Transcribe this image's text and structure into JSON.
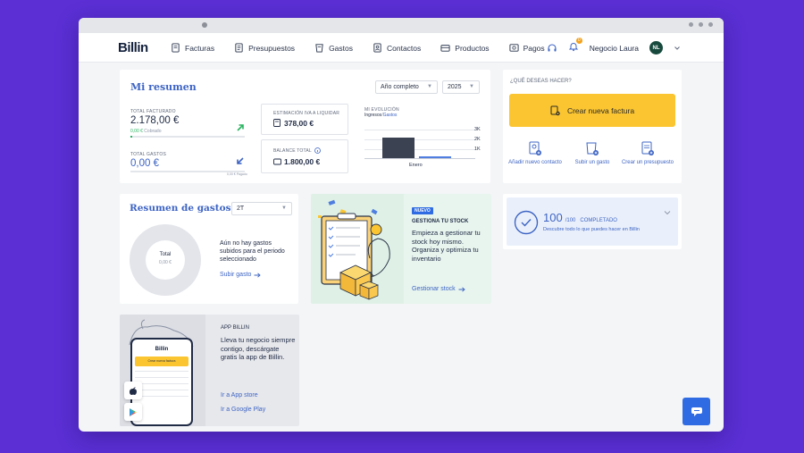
{
  "brand": {
    "logo": "Billin"
  },
  "nav": {
    "items": [
      {
        "label": "Facturas",
        "icon": "invoice-icon"
      },
      {
        "label": "Presupuestos",
        "icon": "quote-icon"
      },
      {
        "label": "Gastos",
        "icon": "expense-icon"
      },
      {
        "label": "Contactos",
        "icon": "contacts-icon"
      },
      {
        "label": "Productos",
        "icon": "products-icon"
      },
      {
        "label": "Pagos",
        "icon": "payments-icon"
      }
    ],
    "notification_count": "0",
    "user_name": "Negocio Laura",
    "user_initials": "NL"
  },
  "resumen": {
    "title": "Mi resumen",
    "period_select": "Año completo",
    "year_select": "2025",
    "facturado_label": "TOTAL FACTURADO",
    "facturado_amount": "2.178,00 €",
    "cobrado_amount": "0,00 €",
    "cobrado_label": "Cobrado",
    "gastos_label": "TOTAL GASTOS",
    "gastos_amount": "0,00 €",
    "pagado_label": "0,00 € Pagado",
    "iva_label": "ESTIMACIÓN IVA A LIQUIDAR",
    "iva_amount": "378,00 €",
    "balance_label": "BALANCE TOTAL",
    "balance_amount": "1.800,00 €",
    "evolucion_label": "MI EVOLUCIÓN",
    "evolucion_ingresos": "Ingresos",
    "evolucion_gastos": "Gastos",
    "ticks": [
      "3K",
      "2K",
      "1K"
    ],
    "month": "Enero"
  },
  "acciones": {
    "heading": "¿QUÉ DESEAS HACER?",
    "create_invoice": "Crear nueva factura",
    "add_contact": "Añadir nuevo contacto",
    "upload_expense": "Subir un gasto",
    "create_quote": "Crear un presupuesto"
  },
  "gastos": {
    "title": "Resumen de gastos",
    "quarter_select": "2T",
    "total_label": "Total",
    "total_amount": "0,00 €",
    "empty_text": "Aún no hay gastos subidos para el periodo seleccionado",
    "upload_link": "Subir gasto"
  },
  "stock": {
    "badge": "NUEVO",
    "heading": "GESTIONA TU STOCK",
    "text": "Empieza a gestionar tu stock hoy mismo. Organiza y optimiza tu inventario",
    "link": "Gestionar stock"
  },
  "completado": {
    "score": "100",
    "total": "/100",
    "label": "COMPLETADO",
    "subtitle": "Descubre todo lo que puedes hacer en Billin"
  },
  "app": {
    "heading": "APP BILLIN",
    "text": "Lleva tu negocio siempre contigo, descárgate gratis la app de Billin.",
    "app_store": "Ir a App store",
    "google_play": "Ir a Google Play",
    "phone_logo": "Billin",
    "phone_button": "Crear nueva factura"
  },
  "colors": {
    "background": "#5b2fd4",
    "accent_blue": "#3d64c4",
    "yellow": "#fbc531",
    "green": "#28b45f"
  }
}
